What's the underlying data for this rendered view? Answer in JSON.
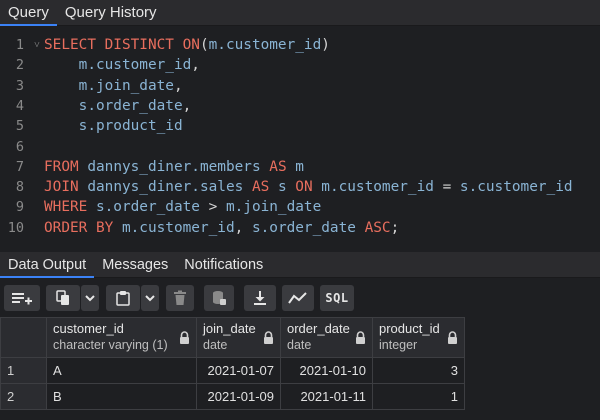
{
  "query_tabs": [
    "Query",
    "Query History"
  ],
  "editor": {
    "lines": [
      {
        "num": "1",
        "fold": true,
        "tokens": [
          [
            "kw",
            "SELECT DISTINCT ON"
          ],
          [
            "op",
            "("
          ],
          [
            "id",
            "m.customer_id"
          ],
          [
            "op",
            ")"
          ]
        ]
      },
      {
        "num": "2",
        "tokens": [
          [
            "op",
            "    "
          ],
          [
            "id",
            "m.customer_id"
          ],
          [
            "op",
            ","
          ]
        ]
      },
      {
        "num": "3",
        "tokens": [
          [
            "op",
            "    "
          ],
          [
            "id",
            "m.join_date"
          ],
          [
            "op",
            ","
          ]
        ]
      },
      {
        "num": "4",
        "tokens": [
          [
            "op",
            "    "
          ],
          [
            "id",
            "s.order_date"
          ],
          [
            "op",
            ","
          ]
        ]
      },
      {
        "num": "5",
        "tokens": [
          [
            "op",
            "    "
          ],
          [
            "id",
            "s.product_id"
          ]
        ]
      },
      {
        "num": "6",
        "tokens": []
      },
      {
        "num": "7",
        "tokens": [
          [
            "kw",
            "FROM "
          ],
          [
            "id",
            "dannys_diner.members "
          ],
          [
            "kw",
            "AS "
          ],
          [
            "id",
            "m"
          ]
        ]
      },
      {
        "num": "8",
        "tokens": [
          [
            "kw",
            "JOIN "
          ],
          [
            "id",
            "dannys_diner.sales "
          ],
          [
            "kw",
            "AS "
          ],
          [
            "id",
            "s "
          ],
          [
            "kw",
            "ON "
          ],
          [
            "id",
            "m.customer_id "
          ],
          [
            "op",
            "= "
          ],
          [
            "id",
            "s.customer_id"
          ]
        ]
      },
      {
        "num": "9",
        "tokens": [
          [
            "kw",
            "WHERE "
          ],
          [
            "id",
            "s.order_date "
          ],
          [
            "op",
            "> "
          ],
          [
            "id",
            "m.join_date"
          ]
        ]
      },
      {
        "num": "10",
        "tokens": [
          [
            "kw",
            "ORDER BY "
          ],
          [
            "id",
            "m.customer_id"
          ],
          [
            "op",
            ", "
          ],
          [
            "id",
            "s.order_date "
          ],
          [
            "kw",
            "ASC"
          ],
          [
            "op",
            ";"
          ]
        ]
      }
    ]
  },
  "panel_tabs": [
    "Data Output",
    "Messages",
    "Notifications"
  ],
  "toolbar": {
    "sql_label": "SQL",
    "icons": [
      "add-row-icon",
      "copy-icon",
      "chevron-down-icon",
      "paste-icon",
      "chevron-down-icon",
      "delete-icon",
      "save-data-icon",
      "download-icon",
      "graph-icon"
    ]
  },
  "grid": {
    "columns": [
      {
        "name": "customer_id",
        "type": "character varying (1)"
      },
      {
        "name": "join_date",
        "type": "date"
      },
      {
        "name": "order_date",
        "type": "date"
      },
      {
        "name": "product_id",
        "type": "integer"
      }
    ],
    "rows": [
      {
        "rn": "1",
        "cells": [
          "A",
          "2021-01-07",
          "2021-01-10",
          "3"
        ]
      },
      {
        "rn": "2",
        "cells": [
          "B",
          "2021-01-09",
          "2021-01-11",
          "1"
        ]
      }
    ]
  },
  "colors": {
    "accent": "#3b82f6",
    "keyword": "#e86e5e",
    "identifier": "#8ab4d4"
  }
}
